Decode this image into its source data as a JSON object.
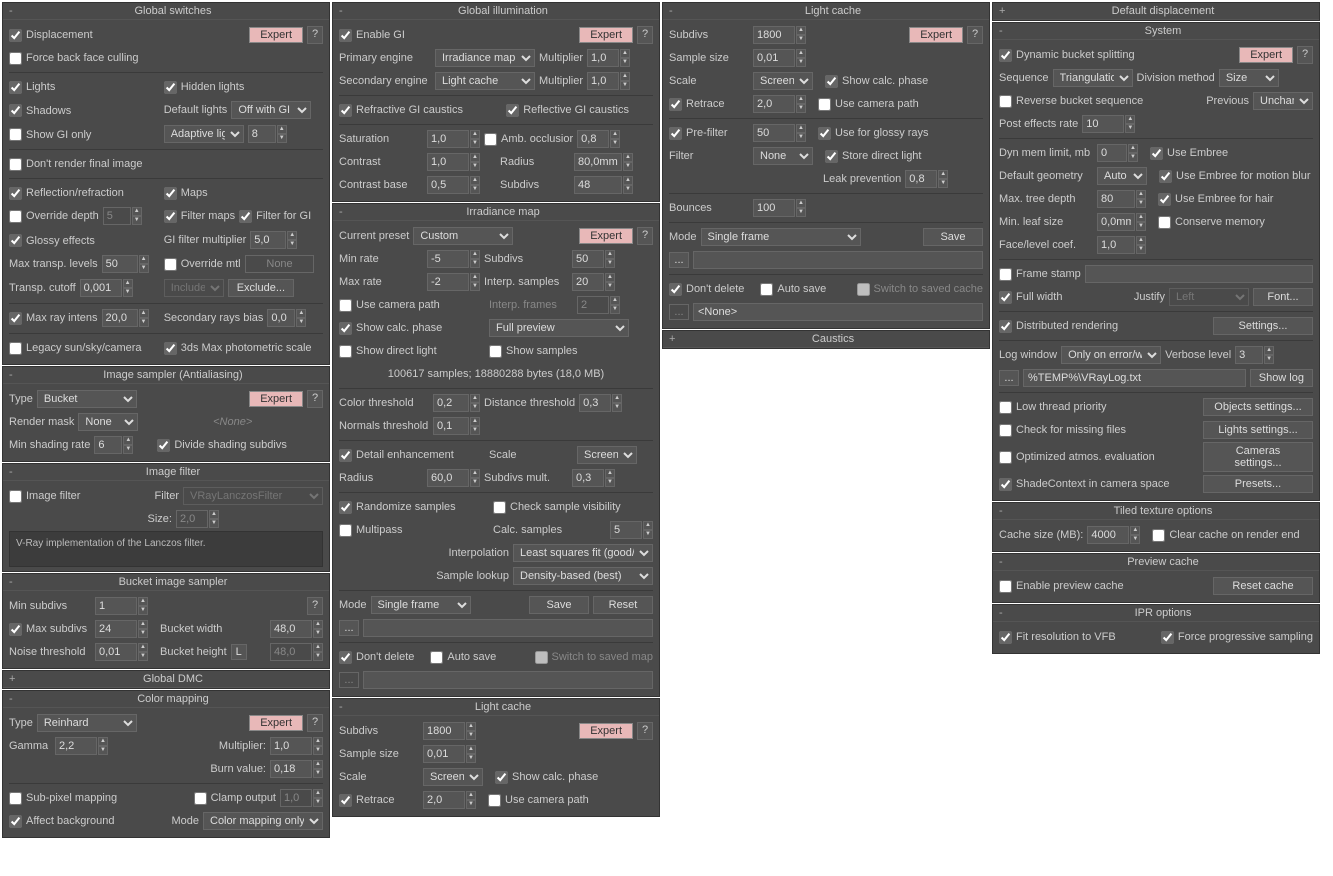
{
  "global_switches": {
    "title": "Global switches",
    "displacement": "Displacement",
    "expert": "Expert",
    "force_bfc": "Force back face culling",
    "lights": "Lights",
    "hidden_lights": "Hidden lights",
    "shadows": "Shadows",
    "default_lights": "Default lights",
    "default_lights_val": "Off with GI",
    "show_gi_only": "Show GI only",
    "adaptive_lights": "Adaptive lights",
    "adaptive_lights_val": "8",
    "dont_render_final": "Don't render final image",
    "refl_refr": "Reflection/refraction",
    "maps": "Maps",
    "override_depth": "Override depth",
    "override_depth_val": "5",
    "filter_maps": "Filter maps",
    "filter_for_gi": "Filter for GI",
    "glossy_effects": "Glossy effects",
    "gi_filter_mult": "GI filter multiplier",
    "gi_filter_mult_val": "5,0",
    "max_transp_levels": "Max transp. levels",
    "max_transp_levels_val": "50",
    "override_mtl": "Override mtl",
    "none": "None",
    "transp_cutoff": "Transp. cutoff",
    "transp_cutoff_val": "0,001",
    "include_exclude": "Include/Exc",
    "exclude": "Exclude...",
    "max_ray_intens": "Max ray intens",
    "max_ray_intens_val": "20,0",
    "secondary_rays_bias": "Secondary rays bias",
    "secondary_rays_bias_val": "0,0",
    "legacy_sun": "Legacy sun/sky/camera",
    "photometric": "3ds Max photometric scale"
  },
  "image_sampler": {
    "title": "Image sampler (Antialiasing)",
    "type": "Type",
    "type_val": "Bucket",
    "expert": "Expert",
    "render_mask": "Render mask",
    "render_mask_val": "None",
    "none": "<None>",
    "min_shading_rate": "Min shading rate",
    "min_shading_rate_val": "6",
    "divide_shading": "Divide shading subdivs"
  },
  "image_filter": {
    "title": "Image filter",
    "image_filter": "Image filter",
    "filter": "Filter",
    "filter_val": "VRayLanczosFilter",
    "size": "Size:",
    "size_val": "2,0",
    "desc": "V-Ray implementation of the Lanczos filter."
  },
  "bucket_sampler": {
    "title": "Bucket image sampler",
    "min_subdivs": "Min subdivs",
    "min_subdivs_val": "1",
    "max_subdivs": "Max subdivs",
    "max_subdivs_val": "24",
    "bucket_width": "Bucket width",
    "bucket_width_val": "48,0",
    "noise_threshold": "Noise threshold",
    "noise_threshold_val": "0,01",
    "bucket_height": "Bucket height",
    "bucket_height_val": "48,0",
    "lock": "L"
  },
  "global_dmc": {
    "title": "Global DMC"
  },
  "color_mapping": {
    "title": "Color mapping",
    "type": "Type",
    "type_val": "Reinhard",
    "expert": "Expert",
    "gamma": "Gamma",
    "gamma_val": "2,2",
    "multiplier": "Multiplier:",
    "multiplier_val": "1,0",
    "burn_value": "Burn value:",
    "burn_value_val": "0,18",
    "sub_pixel": "Sub-pixel mapping",
    "clamp_output": "Clamp output",
    "clamp_val": "1,0",
    "affect_bg": "Affect background",
    "mode": "Mode",
    "mode_val": "Color mapping only"
  },
  "global_illum": {
    "title": "Global illumination",
    "enable_gi": "Enable GI",
    "expert": "Expert",
    "primary_engine": "Primary engine",
    "primary_engine_val": "Irradiance map",
    "multiplier": "Multiplier",
    "multiplier_val": "1,0",
    "secondary_engine": "Secondary engine",
    "secondary_engine_val": "Light cache",
    "multiplier2_val": "1,0",
    "refractive_caustics": "Refractive GI caustics",
    "reflective_caustics": "Reflective GI caustics",
    "saturation": "Saturation",
    "saturation_val": "1,0",
    "amb_occ": "Amb. occlusior",
    "amb_occ_val": "0,8",
    "contrast": "Contrast",
    "contrast_val": "1,0",
    "radius": "Radius",
    "radius_val": "80,0mm",
    "contrast_base": "Contrast base",
    "contrast_base_val": "0,5",
    "subdivs": "Subdivs",
    "subdivs_val": "48"
  },
  "irradiance_map": {
    "title": "Irradiance map",
    "current_preset": "Current preset",
    "current_preset_val": "Custom",
    "expert": "Expert",
    "min_rate": "Min rate",
    "min_rate_val": "-5",
    "subdivs": "Subdivs",
    "subdivs_val": "50",
    "max_rate": "Max rate",
    "max_rate_val": "-2",
    "interp_samples": "Interp. samples",
    "interp_samples_val": "20",
    "use_camera_path": "Use camera path",
    "interp_frames": "Interp. frames",
    "interp_frames_val": "2",
    "show_calc_phase": "Show calc. phase",
    "full_preview": "Full preview",
    "show_direct_light": "Show direct light",
    "show_samples": "Show samples",
    "stats": "100617 samples; 18880288 bytes (18,0 MB)",
    "color_threshold": "Color threshold",
    "color_threshold_val": "0,2",
    "distance_threshold": "Distance threshold",
    "distance_threshold_val": "0,3",
    "normals_threshold": "Normals threshold",
    "normals_threshold_val": "0,1",
    "detail_enhance": "Detail enhancement",
    "scale": "Scale",
    "scale_val": "Screen",
    "radius": "Radius",
    "radius_val": "60,0",
    "subdivs_mult": "Subdivs mult.",
    "subdivs_mult_val": "0,3",
    "randomize_samples": "Randomize samples",
    "check_sample_vis": "Check sample visibility",
    "multipass": "Multipass",
    "calc_samples": "Calc. samples",
    "calc_samples_val": "5",
    "interpolation": "Interpolation",
    "interpolation_val": "Least squares fit (good/sm",
    "sample_lookup": "Sample lookup",
    "sample_lookup_val": "Density-based (best)",
    "mode": "Mode",
    "mode_val": "Single frame",
    "save": "Save",
    "reset": "Reset",
    "dont_delete": "Don't delete",
    "auto_save": "Auto save",
    "switch_saved": "Switch to saved map",
    "dots": "..."
  },
  "light_cache": {
    "title": "Light cache",
    "subdivs": "Subdivs",
    "subdivs_val": "1800",
    "expert": "Expert",
    "sample_size": "Sample size",
    "sample_size_val": "0,01",
    "scale": "Scale",
    "scale_val": "Screen",
    "show_calc_phase": "Show calc. phase",
    "retrace": "Retrace",
    "retrace_val": "2,0",
    "use_camera_path": "Use camera path",
    "pre_filter": "Pre-filter",
    "pre_filter_val": "50",
    "use_glossy": "Use for glossy rays",
    "filter": "Filter",
    "filter_val": "None",
    "store_direct": "Store direct light",
    "leak_prevention": "Leak prevention",
    "leak_prevention_val": "0,8",
    "bounces": "Bounces",
    "bounces_val": "100",
    "mode": "Mode",
    "mode_val": "Single frame",
    "save": "Save",
    "dots": "...",
    "dont_delete": "Don't delete",
    "auto_save": "Auto save",
    "switch_saved": "Switch to saved cache",
    "none": "<None>"
  },
  "caustics": {
    "title": "Caustics"
  },
  "default_disp": {
    "title": "Default displacement"
  },
  "system": {
    "title": "System",
    "dyn_bucket": "Dynamic bucket splitting",
    "expert": "Expert",
    "sequence": "Sequence",
    "sequence_val": "Triangulation",
    "division_method": "Division method",
    "division_method_val": "Size",
    "reverse_bucket": "Reverse bucket sequence",
    "previous": "Previous",
    "previous_val": "Unchange",
    "post_effects": "Post effects rate",
    "post_effects_val": "10",
    "dyn_mem": "Dyn mem limit, mb",
    "dyn_mem_val": "0",
    "use_embree": "Use Embree",
    "default_geom": "Default geometry",
    "default_geom_val": "Auto",
    "use_embree_motion": "Use Embree for motion blur",
    "max_tree_depth": "Max. tree depth",
    "max_tree_depth_val": "80",
    "use_embree_hair": "Use Embree for hair",
    "min_leaf_size": "Min. leaf size",
    "min_leaf_size_val": "0,0mm",
    "conserve_memory": "Conserve memory",
    "face_level": "Face/level coef.",
    "face_level_val": "1,0",
    "frame_stamp": "Frame stamp",
    "full_width": "Full width",
    "justify": "Justify",
    "justify_val": "Left",
    "font": "Font...",
    "distributed": "Distributed rendering",
    "settings": "Settings...",
    "log_window": "Log window",
    "log_window_val": "Only on error/war",
    "verbose_level": "Verbose level",
    "verbose_level_val": "3",
    "log_path": "%TEMP%\\VRayLog.txt",
    "show_log": "Show log",
    "low_thread": "Low thread priority",
    "objects_settings": "Objects settings...",
    "check_missing": "Check for missing files",
    "lights_settings": "Lights settings...",
    "optimized_atmos": "Optimized atmos. evaluation",
    "cameras_settings": "Cameras settings...",
    "shade_context": "ShadeContext in camera space",
    "presets": "Presets...",
    "dots": "..."
  },
  "tiled_texture": {
    "title": "Tiled texture options",
    "cache_size": "Cache size (MB):",
    "cache_size_val": "4000",
    "clear_cache": "Clear cache on render end"
  },
  "preview_cache": {
    "title": "Preview cache",
    "enable": "Enable preview cache",
    "reset": "Reset cache"
  },
  "ipr": {
    "title": "IPR options",
    "fit_res": "Fit resolution to VFB",
    "force_prog": "Force progressive sampling"
  }
}
